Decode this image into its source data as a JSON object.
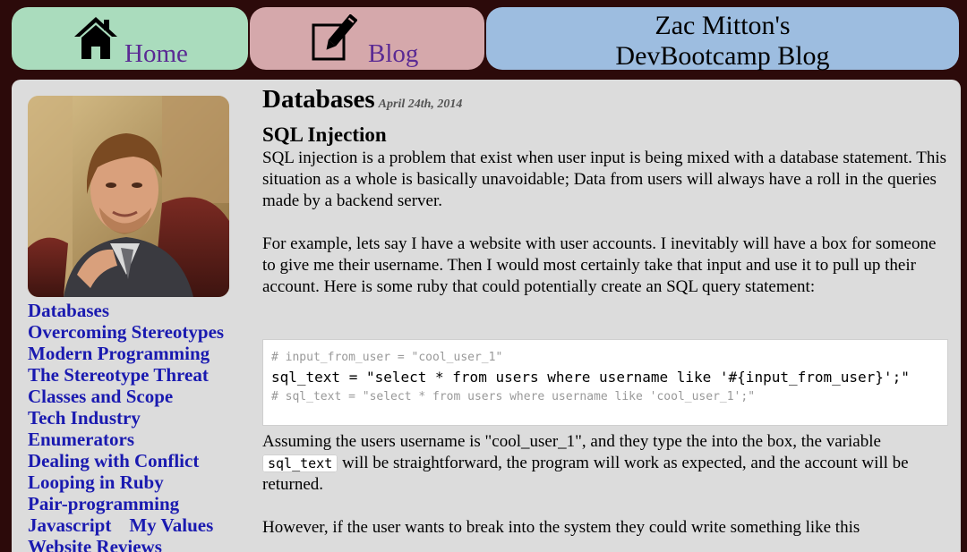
{
  "nav": {
    "home_label": "Home",
    "blog_label": "Blog",
    "site_title_line1": "Zac Mitton's",
    "site_title_line2": "DevBootcamp Blog",
    "home_icon": "home-icon",
    "blog_icon": "pencil-note-icon"
  },
  "sidebar": {
    "items": [
      "Databases",
      "Overcoming Stereotypes",
      "Modern Programming",
      "The Stereotype Threat",
      "Classes and Scope",
      "Tech Industry",
      "Enumerators",
      "Dealing with Conflict",
      "Looping in Ruby",
      "Pair-programming",
      "Javascript",
      "My Values",
      "Website Reviews"
    ]
  },
  "post": {
    "title": "Databases",
    "date": "April 24th, 2014",
    "section_title": "SQL Injection",
    "p1": "SQL injection is a problem that exist when user input is being mixed with a database statement. This situation as a whole is basically unavoidable; Data from users will always have a roll in the queries made by a backend server.",
    "p2": "For example, lets say I have a website with user accounts. I inevitably will have a box for someone to give me their username. Then I would most certainly take that input and use it to pull up their account. Here is some ruby that could potentially create an SQL query statement:",
    "code": {
      "line1": "# input_from_user = \"cool_user_1\"",
      "line2": "sql_text = \"select * from users where username like '#{input_from_user}';\"",
      "line3": "# sql_text = \"select * from users where username like 'cool_user_1';\""
    },
    "p3_before": "Assuming the users username is \"cool_user_1\", and they type the into the box, the variable ",
    "p3_code": "sql_text",
    "p3_after": " will be straightforward, the program will work as expected, and the account will be returned.",
    "p4": "However, if the user wants to break into the system they could write something like this"
  },
  "colors": {
    "background": "#2c0a0a",
    "home_tile": "#aadcbd",
    "blog_tile": "#d5a8ab",
    "title_tile": "#9dbde0",
    "panel": "#dcdcdc",
    "link": "#1a1ab0",
    "nav_label": "#5a2a94"
  }
}
